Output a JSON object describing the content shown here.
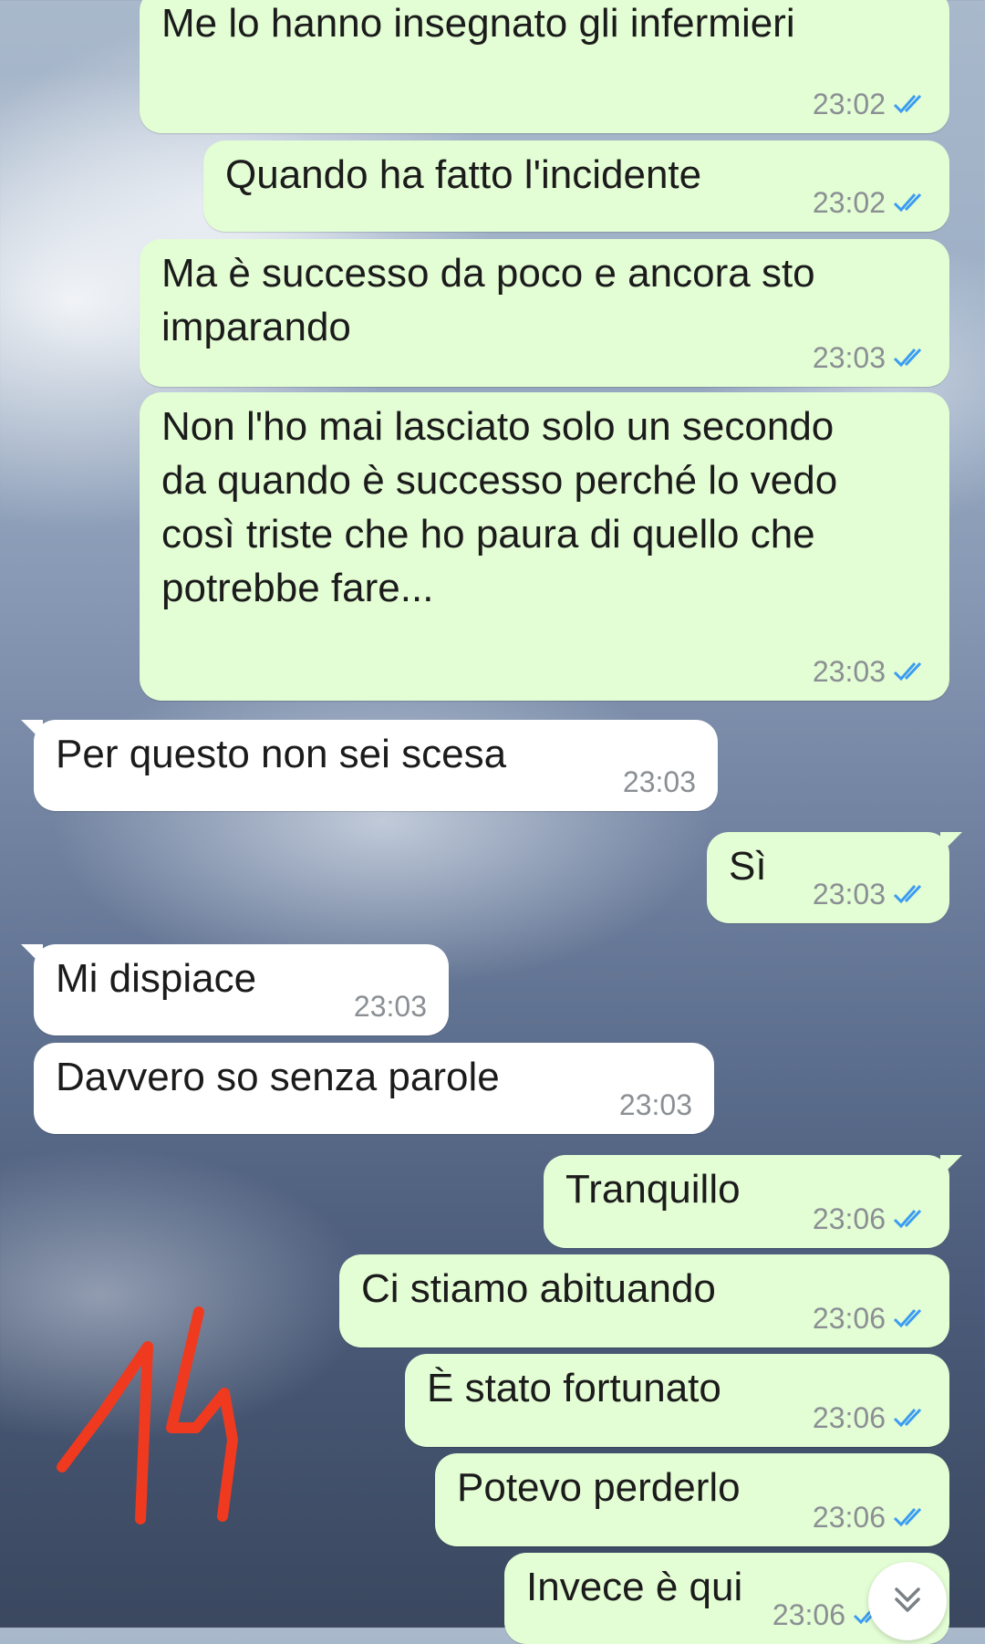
{
  "theme": {
    "outgoing_bubble": "#e3fdd4",
    "incoming_bubble": "#ffffff",
    "text_color": "#1b1b1b",
    "time_color": "#8b8f94",
    "tick_color": "#3b9cf2",
    "annotation_color": "#f03a1f"
  },
  "messages": [
    {
      "direction": "out",
      "text": "Me lo hanno insegnato gli infermieri",
      "time": "23:02",
      "read": true
    },
    {
      "direction": "out",
      "text": "Quando ha fatto l'incidente",
      "time": "23:02",
      "read": true
    },
    {
      "direction": "out",
      "text": "Ma è successo da poco e ancora sto imparando",
      "time": "23:03",
      "read": true
    },
    {
      "direction": "out",
      "text": "Non l'ho mai lasciato solo un secondo da quando è successo perché lo vedo così triste che ho paura di quello che potrebbe fare...",
      "time": "23:03",
      "read": true
    },
    {
      "direction": "in",
      "text": "Per questo non sei scesa",
      "time": "23:03"
    },
    {
      "direction": "out",
      "text": "Sì",
      "time": "23:03",
      "read": true
    },
    {
      "direction": "in",
      "text": "Mi dispiace",
      "time": "23:03"
    },
    {
      "direction": "in",
      "text": "Davvero so senza parole",
      "time": "23:03"
    },
    {
      "direction": "out",
      "text": "Tranquillo",
      "time": "23:06",
      "read": true
    },
    {
      "direction": "out",
      "text": "Ci stiamo abituando",
      "time": "23:06",
      "read": true
    },
    {
      "direction": "out",
      "text": "È stato fortunato",
      "time": "23:06",
      "read": true
    },
    {
      "direction": "out",
      "text": "Potevo perderlo",
      "time": "23:06",
      "read": true
    },
    {
      "direction": "out",
      "text": "Invece è qui",
      "time": "23:06",
      "read": true
    }
  ],
  "annotation": {
    "text": "14"
  },
  "icons": {
    "read_receipt": "double-check-icon",
    "scroll_down": "chevron-double-down-icon"
  }
}
